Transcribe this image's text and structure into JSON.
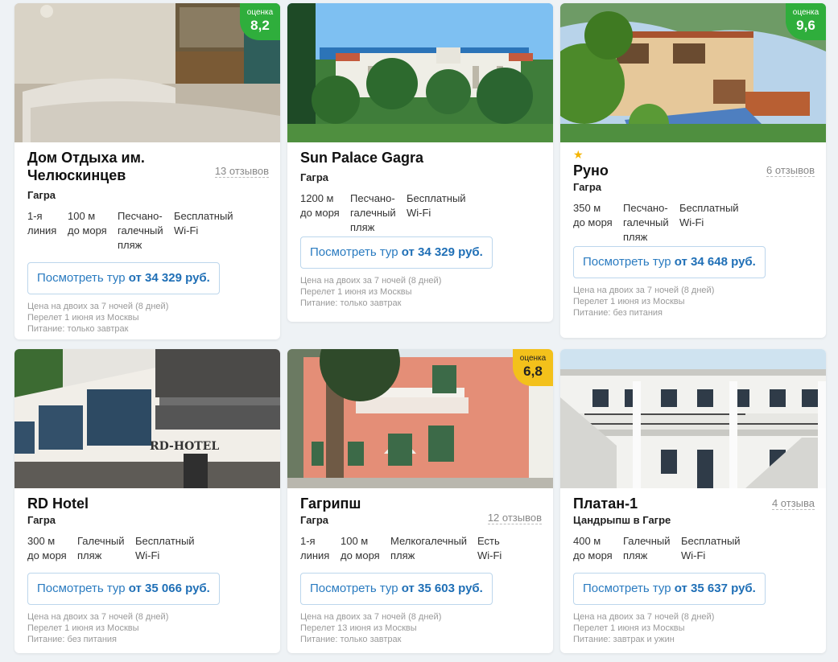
{
  "cards": [
    {
      "name": "Дом Отдыха им. Челюскинцев",
      "reviews": "13 отзывов",
      "city": "Гагра",
      "score_label": "оценка",
      "score": "8,2",
      "features": [
        "1-я линия",
        "100 м до моря",
        "Песчано-галечный пляж",
        "Бесплатный Wi-Fi"
      ],
      "btn_text": "Посмотреть тур",
      "btn_price": "от 34 329 руб.",
      "notes": [
        "Цена на двоих за 7 ночей (8 дней)",
        "Перелет 1 июня из Москвы",
        "Питание: только завтрак"
      ]
    },
    {
      "name": "Sun Palace Gagra",
      "city": "Гагра",
      "features": [
        "1200 м до моря",
        "Песчано-галечный пляж",
        "Бесплатный Wi-Fi"
      ],
      "btn_text": "Посмотреть тур",
      "btn_price": "от 34 329 руб.",
      "notes": [
        "Цена на двоих за 7 ночей (8 дней)",
        "Перелет 1 июня из Москвы",
        "Питание: только завтрак"
      ]
    },
    {
      "name": "Руно",
      "reviews": "6 отзывов",
      "city": "Гагра",
      "stars": "★",
      "score_label": "оценка",
      "score": "9,6",
      "features": [
        "350 м до моря",
        "Песчано-галечный пляж",
        "Бесплатный Wi-Fi"
      ],
      "btn_text": "Посмотреть тур",
      "btn_price": "от 34 648 руб.",
      "notes": [
        "Цена на двоих за 7 ночей (8 дней)",
        "Перелет 1 июня из Москвы",
        "Питание: без питания"
      ]
    },
    {
      "name": "RD Hotel",
      "city": "Гагра",
      "features": [
        "300 м до моря",
        "Галечный пляж",
        "Бесплатный Wi-Fi"
      ],
      "btn_text": "Посмотреть тур",
      "btn_price": "от 35 066 руб.",
      "notes": [
        "Цена на двоих за 7 ночей (8 дней)",
        "Перелет 1 июня из Москвы",
        "Питание: без питания"
      ]
    },
    {
      "name": "Гагрипш",
      "reviews": "12 отзывов",
      "city": "Гагра",
      "score_label": "оценка",
      "score": "6,8",
      "features": [
        "1-я линия",
        "100 м до моря",
        "Мелкогалечный пляж",
        "Есть Wi-Fi"
      ],
      "btn_text": "Посмотреть тур",
      "btn_price": "от 35 603 руб.",
      "notes": [
        "Цена на двоих за 7 ночей (8 дней)",
        "Перелет 13 июня из Москвы",
        "Питание: только завтрак"
      ]
    },
    {
      "name": "Платан-1",
      "reviews": "4 отзыва",
      "city": "Цандрыпш в Гагре",
      "features": [
        "400 м до моря",
        "Галечный пляж",
        "Бесплатный Wi-Fi"
      ],
      "btn_text": "Посмотреть тур",
      "btn_price": "от 35 637 руб.",
      "notes": [
        "Цена на двоих за 7 ночей (8 дней)",
        "Перелет 1 июня из Москвы",
        "Питание: завтрак и ужин"
      ]
    }
  ],
  "colors": {
    "score_green": "#2fae3c",
    "score_yellow": "#f3c11b",
    "link_blue": "#2a7bc0"
  }
}
